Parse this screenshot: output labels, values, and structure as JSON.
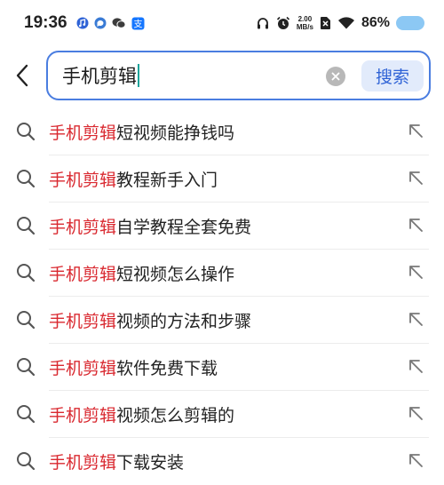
{
  "status_bar": {
    "time": "19:36",
    "net_speed_value": "2.00",
    "net_speed_unit": "MB/s",
    "battery_percent": "86%",
    "app_icons": [
      {
        "name": "music-app-icon",
        "color": "#2f63d6"
      },
      {
        "name": "chat-bubble-app-icon",
        "color": "#3a7bd5"
      },
      {
        "name": "wechat-icon",
        "color": "#3c3c3c"
      },
      {
        "name": "alipay-icon",
        "color": "#1677ff"
      }
    ],
    "system_icons": [
      "headphones-icon",
      "alarm-icon",
      "sim-off-icon",
      "wifi-icon",
      "battery-icon"
    ]
  },
  "search": {
    "query": "手机剪辑",
    "button_label": "搜索",
    "icons": [
      "back-arrow-icon",
      "clear-icon"
    ]
  },
  "suggestions": [
    {
      "highlight": "手机剪辑",
      "rest": "短视频能挣钱吗"
    },
    {
      "highlight": "手机剪辑",
      "rest": "教程新手入门"
    },
    {
      "highlight": "手机剪辑",
      "rest": "自学教程全套免费"
    },
    {
      "highlight": "手机剪辑",
      "rest": "短视频怎么操作"
    },
    {
      "highlight": "手机剪辑",
      "rest": "视频的方法和步骤"
    },
    {
      "highlight": "手机剪辑",
      "rest": "软件免费下载"
    },
    {
      "highlight": "手机剪辑",
      "rest": "视频怎么剪辑的"
    },
    {
      "highlight": "手机剪辑",
      "rest": "下载安装"
    }
  ],
  "colors": {
    "highlight": "#d9282f",
    "accent": "#2f63d6",
    "search_border": "#4a7de0",
    "search_button_bg": "#e2ebfb"
  }
}
